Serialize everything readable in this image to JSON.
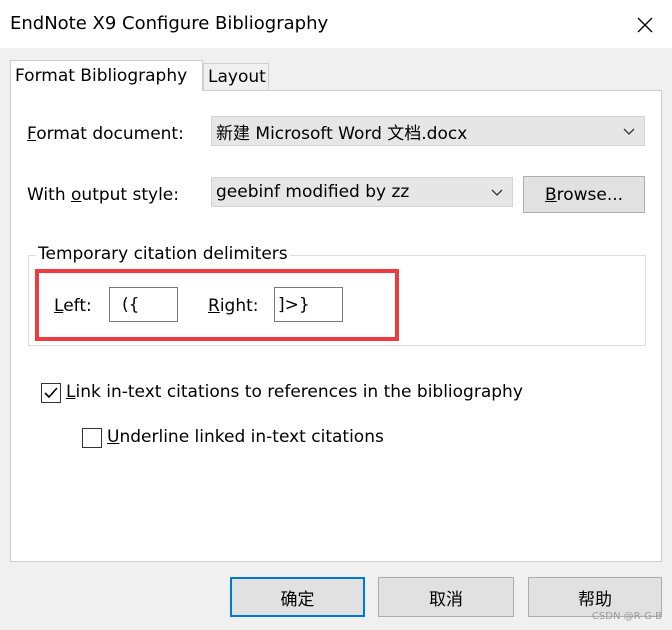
{
  "window": {
    "title": "EndNote X9 Configure Bibliography"
  },
  "tabs": [
    {
      "label": "Format Bibliography"
    },
    {
      "label": "Layout"
    }
  ],
  "format_document": {
    "label_prefix": "",
    "label_mnemonic": "F",
    "label_rest": "ormat document:",
    "value": "新建 Microsoft Word 文档.docx"
  },
  "output_style": {
    "label_prefix": "With ",
    "label_mnemonic": "o",
    "label_rest": "utput style:",
    "value": "geebinf modified by zz",
    "browse_mnemonic": "B",
    "browse_rest": "rowse..."
  },
  "delimiters": {
    "group_title": "Temporary citation delimiters",
    "left_mnemonic": "L",
    "left_rest": "eft:",
    "left_value": "({",
    "right_mnemonic": "R",
    "right_rest": "ight:",
    "right_value": "]>}"
  },
  "options": {
    "link_mnemonic": "L",
    "link_rest": "ink in-text citations to references in the bibliography",
    "link_checked": true,
    "underline_mnemonic": "U",
    "underline_rest": "nderline linked in-text citations",
    "underline_checked": false
  },
  "footer": {
    "ok": "确定",
    "cancel": "取消",
    "help": "帮助"
  },
  "watermark": "CSDN @R-G-B",
  "colors": {
    "highlight": "#ef3b3f",
    "accent": "#0078d7"
  }
}
